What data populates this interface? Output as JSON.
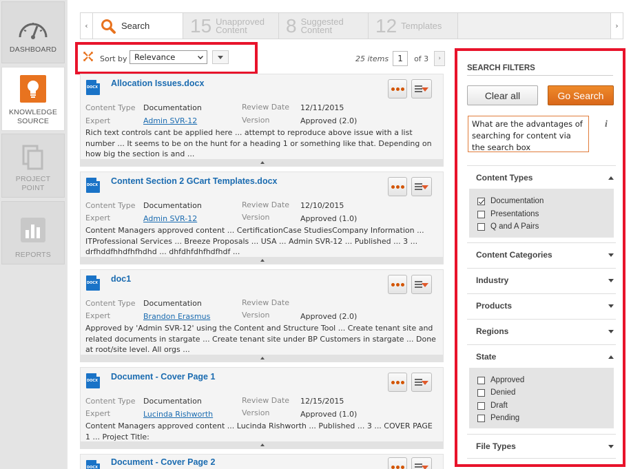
{
  "nav": {
    "items": [
      {
        "label": "DASHBOARD"
      },
      {
        "label": "KNOWLEDGE SOURCE"
      },
      {
        "label": "PROJECT POINT"
      },
      {
        "label": "REPORTS"
      }
    ]
  },
  "tabs": [
    {
      "count": "",
      "label": "Search"
    },
    {
      "count": "15",
      "label": "Unapproved Content"
    },
    {
      "count": "8",
      "label": "Suggested Content"
    },
    {
      "count": "12",
      "label": "Templates"
    }
  ],
  "sort": {
    "label": "Sort by",
    "value": "Relevance"
  },
  "pager": {
    "items": "25 items",
    "page": "1",
    "of": "of 3",
    "next": "›"
  },
  "meta_labels": {
    "content_type": "Content Type",
    "review_date": "Review Date",
    "expert": "Expert",
    "version": "Version"
  },
  "results": [
    {
      "title": "Allocation Issues.docx",
      "content_type": "Documentation",
      "review_date": "12/11/2015",
      "expert": "Admin SVR-12",
      "version": "Approved (2.0)",
      "snippet": "Rich text controls cant be applied here ... attempt to reproduce above issue with a list number ... It seems to be on the hunt for a heading 1 or something like that. Depending on how big the section is and ..."
    },
    {
      "title": "Content Section 2 GCart Templates.docx",
      "content_type": "Documentation",
      "review_date": "12/10/2015",
      "expert": "Admin SVR-12",
      "version": "Approved (1.0)",
      "snippet": "Content Managers approved content ... CertificationCase StudiesCompany Information ... ITProfessional Services ... Breeze Proposals ... USA ... Admin SVR-12 ... Published ... 3 ... drfhddfhhdfhfhdhd ... dhfdhfdhfhdfhdf ..."
    },
    {
      "title": "doc1",
      "content_type": "Documentation",
      "review_date": "",
      "expert": "Brandon Erasmus",
      "version": "Approved (2.0)",
      "snippet": "Approved by 'Admin SVR-12' using the Content and Structure Tool ... Create tenant site and related documents in stargate ... Create tenant site under BP Customers in stargate ... Done at root/site level. All orgs ..."
    },
    {
      "title": "Document - Cover Page 1",
      "content_type": "Documentation",
      "review_date": "12/15/2015",
      "expert": "Lucinda Rishworth",
      "version": "Approved (1.0)",
      "snippet": "Content Managers approved content ... Lucinda Rishworth ... Published ... 3 ... COVER PAGE 1 ... Project Title:"
    },
    {
      "title": "Document - Cover Page 2"
    }
  ],
  "filters": {
    "title": "SEARCH FILTERS",
    "clear": "Clear all",
    "go": "Go Search",
    "query": "What are the advantages of searching for content via the search box",
    "info": "i",
    "sections": [
      {
        "label": "Content Types"
      },
      {
        "label": "Content Categories"
      },
      {
        "label": "Industry"
      },
      {
        "label": "Products"
      },
      {
        "label": "Regions"
      },
      {
        "label": "State"
      },
      {
        "label": "File Types"
      }
    ],
    "content_types": [
      {
        "label": "Documentation",
        "checked": true
      },
      {
        "label": "Presentations",
        "checked": false
      },
      {
        "label": "Q and A Pairs",
        "checked": false
      }
    ],
    "states": [
      {
        "label": "Approved",
        "checked": false
      },
      {
        "label": "Denied",
        "checked": false
      },
      {
        "label": "Draft",
        "checked": false
      },
      {
        "label": "Pending",
        "checked": false
      }
    ]
  },
  "colors": {
    "accent": "#e07b39",
    "highlight": "#e8132b",
    "link": "#1a6bb0"
  }
}
